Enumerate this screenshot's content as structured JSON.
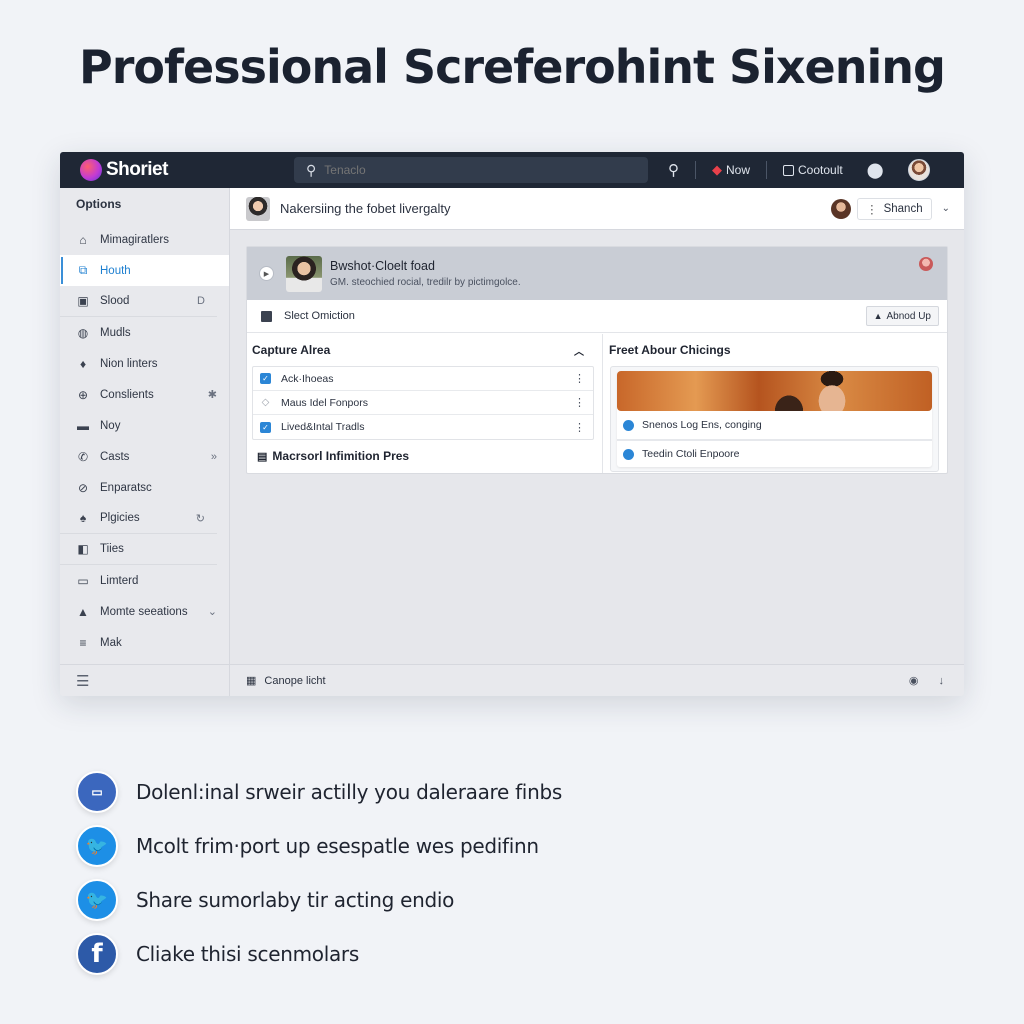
{
  "hero": {
    "title": "Professional Screferohint Sixening"
  },
  "topbar": {
    "brand": "Shoriet",
    "search_placeholder": "Tenaclo",
    "now_label": "Now",
    "cout_label": "Cootoult",
    "icons": {
      "search": "🔍",
      "now": "🎬",
      "pin": "📍"
    }
  },
  "sidebar": {
    "title": "Options",
    "items": [
      {
        "label": "Mimagiratlers",
        "icon": "⌂",
        "trail": ""
      },
      {
        "label": "Houth",
        "icon": "⧉",
        "trail": "",
        "active": true
      },
      {
        "label": "Slood",
        "icon": "▣",
        "trail": "D"
      },
      {
        "label": "Mudls",
        "icon": "◍",
        "trail": ""
      },
      {
        "label": "Nion linters",
        "icon": "♦",
        "trail": ""
      },
      {
        "label": "Conslients",
        "icon": "⊕",
        "trail": "✱"
      },
      {
        "label": "Noy",
        "icon": "▬",
        "trail": ""
      },
      {
        "label": "Casts",
        "icon": "✆",
        "trail": "»"
      },
      {
        "label": "Enparatsc",
        "icon": "⊘",
        "trail": ""
      },
      {
        "label": "Plgicies",
        "icon": "♠",
        "trail": "↻"
      },
      {
        "label": "Tiies",
        "icon": "◧",
        "trail": ""
      },
      {
        "label": "Limterd",
        "icon": "▭",
        "trail": ""
      },
      {
        "label": "Momte seeations",
        "icon": "▲",
        "trail": "⌄"
      },
      {
        "label": "Mak",
        "icon": "≡",
        "trail": ""
      }
    ],
    "footer_icon": "☰"
  },
  "subheader": {
    "title": "Nakersiing the fobet livergalty",
    "button_label": "Shanch",
    "caret": "⌄"
  },
  "card": {
    "title": "Bwshot·Cloelt foad",
    "subtitle": "GM. steochied rocial, tredilr by pictimgolce.",
    "select_label": "Slect Omiction",
    "action_label": "Abnod Up",
    "left": {
      "title": "Capture Alrea",
      "items": [
        {
          "label": "Ack·Ihoeas",
          "checked": true
        },
        {
          "label": "Maus Idel Fonpors",
          "checked": false
        },
        {
          "label": "Lived&Intal Tradls",
          "checked": true
        }
      ],
      "footer": "Macrsorl Infimition Pres"
    },
    "right": {
      "title": "Freet Abour Chicings",
      "rows": [
        {
          "label": "Snenos Log Ens, conging"
        },
        {
          "label": "Teedin Ctoli Enpoore"
        }
      ]
    }
  },
  "statusbar": {
    "label": "Canope licht"
  },
  "features": [
    {
      "icon": "message-icon",
      "glyph": "▭",
      "style": "dot",
      "text": "Dolenl:inal srweir actilly you daleraare finbs"
    },
    {
      "icon": "twitter-icon",
      "glyph": "🐦",
      "style": "tw",
      "text": "Mcolt frim·port up esespatle wes pedifinn"
    },
    {
      "icon": "twitter-icon",
      "glyph": "🐦",
      "style": "tw",
      "text": "Share sumorlaby tir acting endio"
    },
    {
      "icon": "facebook-icon",
      "glyph": "f",
      "style": "fb",
      "text": "Cliake thisi scenmolars"
    }
  ],
  "colors": {
    "topbar": "#1f2735",
    "accent": "#1d7fd0",
    "checkbox": "#2b86d6"
  }
}
